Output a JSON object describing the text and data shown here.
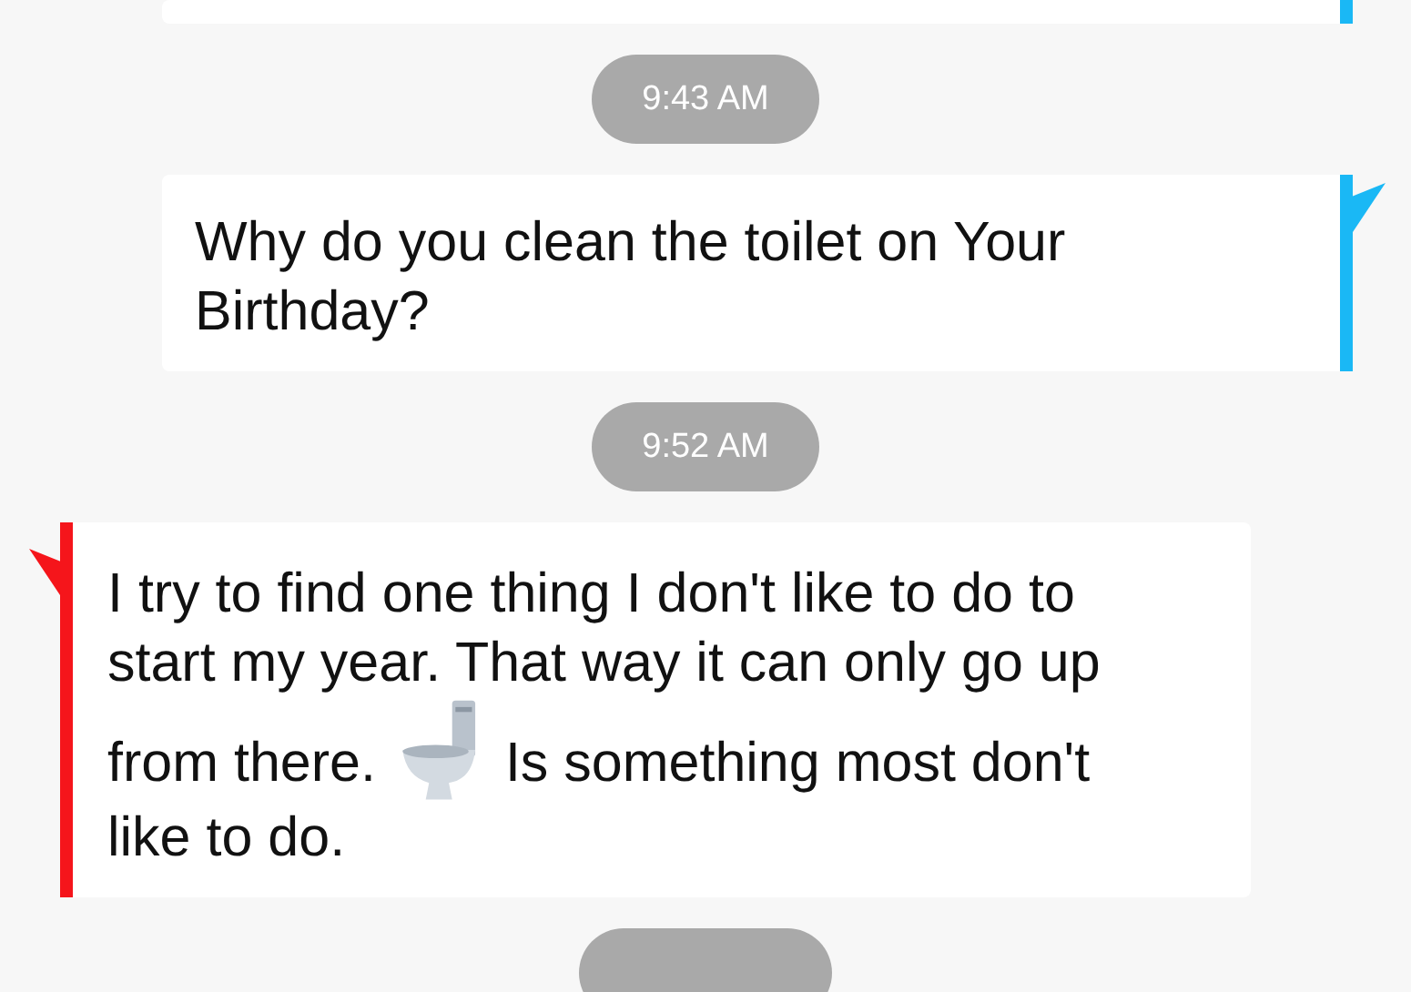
{
  "conversation": [
    {
      "kind": "message",
      "sent": true,
      "color": "#1ab8f5"
    },
    {
      "kind": "time",
      "text": "9:43 AM"
    },
    {
      "kind": "message",
      "sent": true,
      "color": "#1ab8f5",
      "segments": [
        {
          "kind": "text",
          "text": "Why do you clean the toilet on Your Birthday?"
        }
      ]
    },
    {
      "kind": "time",
      "text": "9:52 AM"
    },
    {
      "kind": "message",
      "sent": false,
      "color": "#f5151b",
      "segments": [
        {
          "kind": "text",
          "text": "I try to find one thing I don't like to do to start my year. That way it can only go up"
        },
        {
          "kind": "break"
        },
        {
          "kind": "text",
          "text": "from there."
        },
        {
          "kind": "toilet"
        },
        {
          "kind": "text",
          "text": "Is something most don't"
        },
        {
          "kind": "break"
        },
        {
          "kind": "text",
          "text": "like to do."
        }
      ]
    },
    {
      "kind": "time"
    }
  ]
}
